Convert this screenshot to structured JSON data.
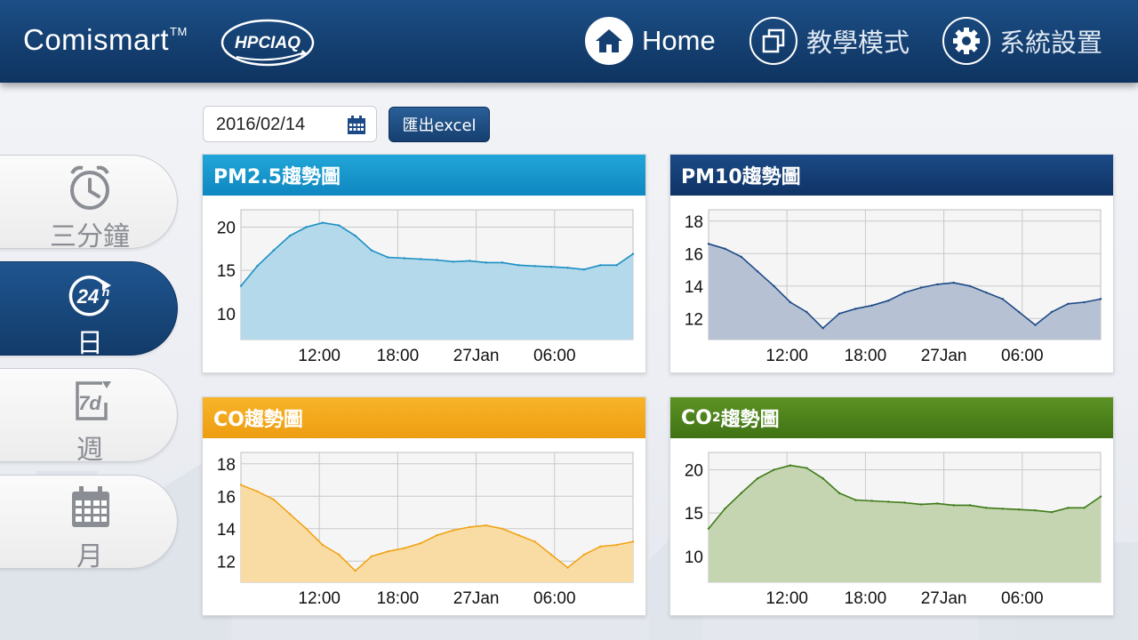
{
  "header": {
    "brand": "Comismart",
    "brand_tm": "TM",
    "partner_logo": "HPCIAQ",
    "nav": [
      {
        "label": "Home",
        "icon": "home-icon"
      },
      {
        "label": "教學模式",
        "icon": "copy-icon"
      },
      {
        "label": "系統設置",
        "icon": "gear-icon"
      }
    ]
  },
  "toolbar": {
    "date_value": "2016/02/14",
    "export_label": "匯出excel"
  },
  "sidebar": {
    "items": [
      {
        "label": "三分鐘",
        "icon": "alarm-clock-icon",
        "active": false
      },
      {
        "label": "日",
        "icon": "24h-icon",
        "icon_text": "24",
        "icon_sup": "h",
        "active": true
      },
      {
        "label": "週",
        "icon": "7d-icon",
        "icon_text": "7d",
        "active": false
      },
      {
        "label": "月",
        "icon": "calendar-month-icon",
        "active": false
      }
    ]
  },
  "colors": {
    "header": "#143f70",
    "pm25": "#1596cc",
    "pm10": "#1c4a86",
    "co": "#f2a51a",
    "co2": "#4d8420",
    "active_tab": "#1a4a80"
  },
  "chart_data": [
    {
      "type": "area",
      "title": "PM2.5趨勢圖",
      "xticks": [
        "12:00",
        "18:00",
        "27Jan",
        "06:00"
      ],
      "ylim": [
        7,
        22
      ],
      "yticks": [
        10,
        15,
        20
      ],
      "grid": true,
      "line_color": "#1a8fc4",
      "fill_color": "#b3d9ea",
      "series": [
        {
          "x": [
            0,
            1,
            2,
            3,
            4,
            5,
            6,
            7,
            8,
            9,
            10,
            11,
            12,
            13,
            14,
            15,
            16,
            17,
            18,
            19,
            20,
            21,
            22,
            23,
            24
          ],
          "values": [
            13.2,
            15.5,
            17.3,
            19.0,
            20.0,
            20.5,
            20.2,
            19.0,
            17.3,
            16.5,
            16.4,
            16.3,
            16.2,
            16.0,
            16.1,
            15.9,
            15.9,
            15.6,
            15.5,
            15.4,
            15.3,
            15.1,
            15.6,
            15.6,
            16.9
          ]
        }
      ]
    },
    {
      "type": "area",
      "title": "PM10趨勢圖",
      "xticks": [
        "12:00",
        "18:00",
        "27Jan",
        "06:00"
      ],
      "ylim": [
        10.7,
        18.7
      ],
      "yticks": [
        12,
        14,
        16,
        18
      ],
      "grid": true,
      "line_color": "#1c4a86",
      "fill_color": "#b6c2d3",
      "series": [
        {
          "x": [
            0,
            1,
            2,
            3,
            4,
            5,
            6,
            7,
            8,
            9,
            10,
            11,
            12,
            13,
            14,
            15,
            16,
            17,
            18,
            19,
            20,
            21,
            22,
            23,
            24
          ],
          "values": [
            16.6,
            16.3,
            15.8,
            14.9,
            14.0,
            13.0,
            12.4,
            11.4,
            12.3,
            12.6,
            12.8,
            13.1,
            13.6,
            13.9,
            14.1,
            14.2,
            14.0,
            13.6,
            13.2,
            12.4,
            11.6,
            12.4,
            12.9,
            13.0,
            13.2
          ]
        }
      ]
    },
    {
      "type": "area",
      "title": "CO趨勢圖",
      "xticks": [
        "12:00",
        "18:00",
        "27Jan",
        "06:00"
      ],
      "ylim": [
        10.7,
        18.7
      ],
      "yticks": [
        12,
        14,
        16,
        18
      ],
      "grid": true,
      "line_color": "#f0a418",
      "fill_color": "#f8dca4",
      "series": [
        {
          "x": [
            0,
            1,
            2,
            3,
            4,
            5,
            6,
            7,
            8,
            9,
            10,
            11,
            12,
            13,
            14,
            15,
            16,
            17,
            18,
            19,
            20,
            21,
            22,
            23,
            24
          ],
          "values": [
            16.7,
            16.3,
            15.8,
            14.9,
            14.0,
            13.0,
            12.4,
            11.4,
            12.3,
            12.6,
            12.8,
            13.1,
            13.6,
            13.9,
            14.1,
            14.2,
            14.0,
            13.6,
            13.2,
            12.4,
            11.6,
            12.4,
            12.9,
            13.0,
            13.2
          ]
        }
      ]
    },
    {
      "type": "area",
      "title": "CO",
      "title_sub": "2",
      "title_suffix": "趨勢圖",
      "xticks": [
        "12:00",
        "18:00",
        "27Jan",
        "06:00"
      ],
      "ylim": [
        7,
        22
      ],
      "yticks": [
        10,
        15,
        20
      ],
      "grid": true,
      "line_color": "#3d7a18",
      "fill_color": "#c5d5b1",
      "series": [
        {
          "x": [
            0,
            1,
            2,
            3,
            4,
            5,
            6,
            7,
            8,
            9,
            10,
            11,
            12,
            13,
            14,
            15,
            16,
            17,
            18,
            19,
            20,
            21,
            22,
            23,
            24
          ],
          "values": [
            13.2,
            15.5,
            17.3,
            19.0,
            20.0,
            20.5,
            20.2,
            19.0,
            17.3,
            16.5,
            16.4,
            16.3,
            16.2,
            16.0,
            16.1,
            15.9,
            15.9,
            15.6,
            15.5,
            15.4,
            15.3,
            15.1,
            15.6,
            15.6,
            16.9
          ]
        }
      ]
    }
  ]
}
